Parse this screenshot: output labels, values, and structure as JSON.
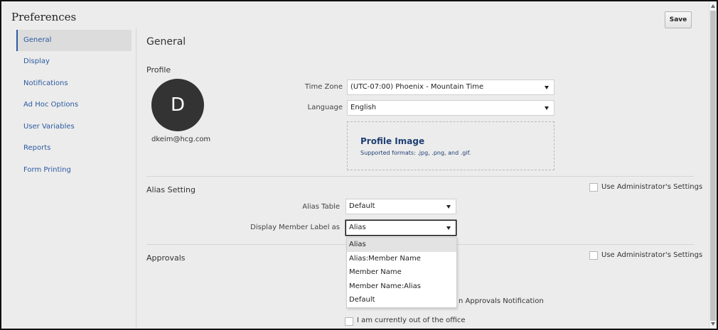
{
  "app": {
    "title": "Preferences",
    "save_label": "Save"
  },
  "sidebar": {
    "items": [
      {
        "label": "General",
        "active": true
      },
      {
        "label": "Display"
      },
      {
        "label": "Notifications"
      },
      {
        "label": "Ad Hoc Options"
      },
      {
        "label": "User Variables"
      },
      {
        "label": "Reports"
      },
      {
        "label": "Form Printing"
      }
    ]
  },
  "main": {
    "page_title": "General",
    "profile": {
      "section_title": "Profile",
      "avatar_letter": "D",
      "email": "dkeim@hcg.com",
      "time_zone_label": "Time Zone",
      "time_zone_value": "(UTC-07:00) Phoenix - Mountain Time",
      "language_label": "Language",
      "language_value": "English",
      "image_title": "Profile Image",
      "image_formats": "Supported formats: .jpg, .png, and .gif."
    },
    "alias": {
      "section_title": "Alias Setting",
      "use_admin_label": "Use Administrator's Settings",
      "alias_table_label": "Alias Table",
      "alias_table_value": "Default",
      "display_member_label": "Display Member Label as",
      "display_member_value": "Alias",
      "options": [
        "Alias",
        "Alias:Member Name",
        "Member Name",
        "Member Name:Alias",
        "Default"
      ]
    },
    "approvals": {
      "section_title": "Approvals",
      "use_admin_label": "Use Administrator's Settings",
      "partial_notification_label": "n Approvals Notification",
      "out_of_office_label": "I am currently out of the office"
    }
  },
  "colors": {
    "link": "#2c5aa0",
    "profile_image_text": "#1f3f73",
    "avatar_bg": "#333333",
    "panel_bg": "#ececec"
  }
}
